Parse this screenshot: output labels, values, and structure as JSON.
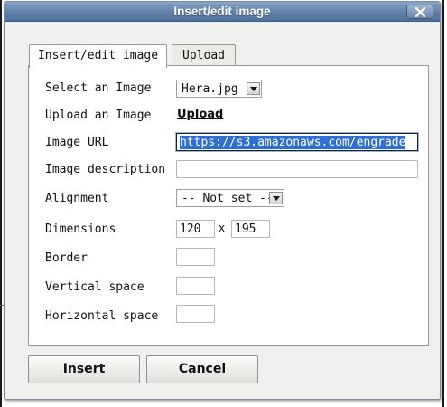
{
  "dialog": {
    "title": "Insert/edit image",
    "close_icon": "close-x-icon"
  },
  "tabs": [
    {
      "label": "Insert/edit image",
      "active": true
    },
    {
      "label": "Upload",
      "active": false
    }
  ],
  "form": {
    "select_image": {
      "label": "Select an Image",
      "value": "Hera.jpg"
    },
    "upload_image": {
      "label": "Upload an Image",
      "link_text": "Upload"
    },
    "image_url": {
      "label": "Image URL",
      "value": "https://s3.amazonaws.com/engrade"
    },
    "image_description": {
      "label": "Image description",
      "value": ""
    },
    "alignment": {
      "label": "Alignment",
      "value": "-- Not set --"
    },
    "dimensions": {
      "label": "Dimensions",
      "width": "120",
      "separator": "x",
      "height": "195"
    },
    "border": {
      "label": "Border",
      "value": ""
    },
    "vertical_space": {
      "label": "Vertical space",
      "value": ""
    },
    "horizontal_space": {
      "label": "Horizontal space",
      "value": ""
    }
  },
  "buttons": {
    "insert_label": "Insert",
    "cancel_label": "Cancel"
  },
  "colors": {
    "titlebar": "#5e7fa8",
    "dialog_bg": "#f0f0ee",
    "selection": "#2f6ed3"
  }
}
